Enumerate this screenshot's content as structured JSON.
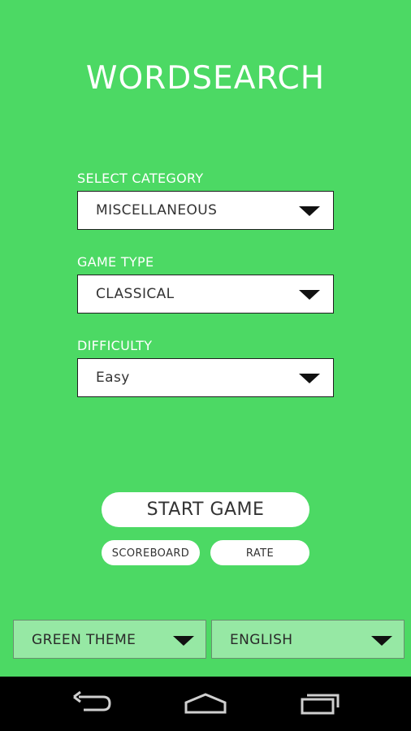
{
  "app": {
    "title": "WORDSEARCH"
  },
  "category": {
    "label": "SELECT CATEGORY",
    "value": "MISCELLANEOUS"
  },
  "game_type": {
    "label": "GAME TYPE",
    "value": "CLASSICAL"
  },
  "difficulty": {
    "label": "DIFFICULTY",
    "value": "Easy"
  },
  "actions": {
    "start": "START GAME",
    "scoreboard": "SCOREBOARD",
    "rate": "RATE"
  },
  "footer": {
    "theme": "GREEN THEME",
    "language": "ENGLISH"
  },
  "colors": {
    "background": "#4cd964",
    "footer_select": "#96e8a4",
    "navbar": "#000000"
  },
  "icons": {
    "dropdown": "chevron-down-icon",
    "back": "back-icon",
    "home": "home-icon",
    "recent": "recent-apps-icon"
  }
}
